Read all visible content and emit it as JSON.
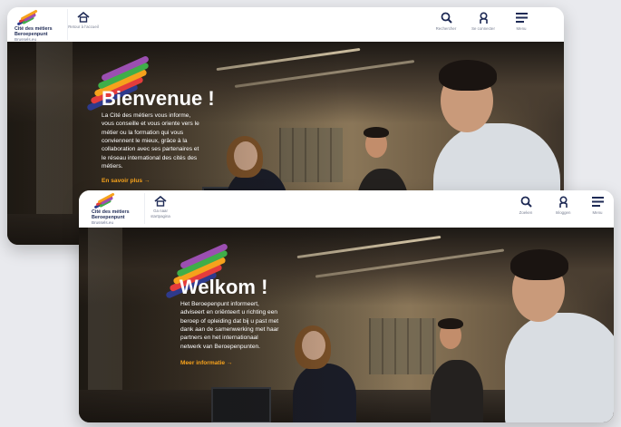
{
  "screens": [
    {
      "id": "fr",
      "logo": {
        "line1": "Cité des métiers",
        "line2": "Beroepenpunt",
        "line3": "Brussels.eu"
      },
      "home": {
        "label": "Retour à l'accueil",
        "icon": "home-icon"
      },
      "tools": [
        {
          "label": "Rechercher",
          "icon": "search-icon"
        },
        {
          "label": "Se connecter",
          "icon": "user-icon"
        },
        {
          "label": "Menu",
          "icon": "menu-icon"
        }
      ],
      "hero": {
        "title": "Bienvenue !",
        "text": "La Cité des métiers vous informe,\nvous conseille et vous oriente vers le\nmétier ou la formation qui vous\nconviennent le mieux, grâce à la\ncollaboration avec ses partenaires et\nle réseau international des cités des\nmétiers.",
        "link": "En savoir plus →"
      }
    },
    {
      "id": "nl",
      "logo": {
        "line1": "Cité des métiers",
        "line2": "Beroepenpunt",
        "line3": "Brussels.eu"
      },
      "home": {
        "label": "Ga naar startpagina",
        "icon": "home-icon"
      },
      "tools": [
        {
          "label": "Zoeken",
          "icon": "search-icon"
        },
        {
          "label": "Inloggen",
          "icon": "user-icon"
        },
        {
          "label": "Menu",
          "icon": "menu-icon"
        }
      ],
      "hero": {
        "title": "Welkom !",
        "text": "Het Beroepenpunt informeert,\nadviseert en oriënteert u richting een\nberoep of opleiding dat bij u past met\ndank aan de samenwerking met haar\npartners en het internationaal\nnetwerk van Beroepenpunten.",
        "link": "Meer informatie →"
      }
    }
  ],
  "colors": {
    "navy": "#1e2a55",
    "accent": "#f6a21c",
    "brush": [
      "#2e3a8c",
      "#e43c3c",
      "#f6a21c",
      "#3fae49",
      "#9b4fb1"
    ]
  }
}
